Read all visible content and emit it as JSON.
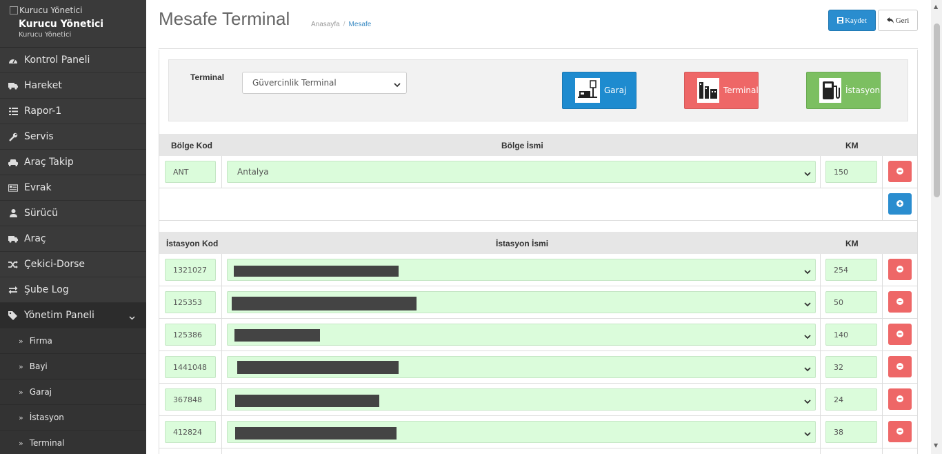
{
  "sidebar": {
    "logo_alt": "Kurucu Yönetici",
    "user_name": "Kurucu Yönetici",
    "user_role": "Kurucu Yönetici",
    "items": [
      {
        "label": "Kontrol Paneli",
        "icon": "dashboard-icon"
      },
      {
        "label": "Hareket",
        "icon": "truck-icon"
      },
      {
        "label": "Rapor-1",
        "icon": "list-icon"
      },
      {
        "label": "Servis",
        "icon": "wrench-icon"
      },
      {
        "label": "Araç Takip",
        "icon": "car-icon"
      },
      {
        "label": "Evrak",
        "icon": "newspaper-icon"
      },
      {
        "label": "Sürücü",
        "icon": "user-icon"
      },
      {
        "label": "Araç",
        "icon": "truck-icon"
      },
      {
        "label": "Çekici-Dorse",
        "icon": "random-icon"
      },
      {
        "label": "Şube Log",
        "icon": "exchange-icon"
      },
      {
        "label": "Yönetim Paneli",
        "icon": "tags-icon"
      }
    ],
    "sub_items": [
      "Firma",
      "Bayi",
      "Garaj",
      "İstasyon",
      "Terminal"
    ]
  },
  "header": {
    "title": "Mesafe Terminal",
    "breadcrumb": [
      "Anasayfa",
      "Mesafe"
    ],
    "save_label": "Kaydet",
    "back_label": "Geri"
  },
  "filter": {
    "label": "Terminal",
    "selected": "Güvercinlik Terminal",
    "buttons": [
      {
        "label": "Garaj",
        "color": "#1e8bcf"
      },
      {
        "label": "Terminal",
        "color": "#ee6767"
      },
      {
        "label": "İstasyon",
        "color": "#7cbf61"
      }
    ]
  },
  "region_table": {
    "headers": {
      "code": "Bölge Kod",
      "name": "Bölge İsmi",
      "km": "KM"
    },
    "rows": [
      {
        "code": "ANT",
        "name": "Antalya",
        "km": "150"
      }
    ]
  },
  "station_table": {
    "headers": {
      "code": "İstasyon Kod",
      "name": "İstasyon İsmi",
      "km": "KM"
    },
    "rows": [
      {
        "code": "1321027",
        "km": "254"
      },
      {
        "code": "125353",
        "km": "50"
      },
      {
        "code": "125386",
        "km": "140"
      },
      {
        "code": "1441048",
        "km": "32"
      },
      {
        "code": "367848",
        "km": "24"
      },
      {
        "code": "412824",
        "km": "38"
      }
    ]
  },
  "colors": {
    "primary": "#2a8dcf",
    "danger": "#ee6767",
    "success": "#7cbf61",
    "input_bg": "#dbfcdb",
    "sidebar_bg": "#3a3a3a"
  }
}
